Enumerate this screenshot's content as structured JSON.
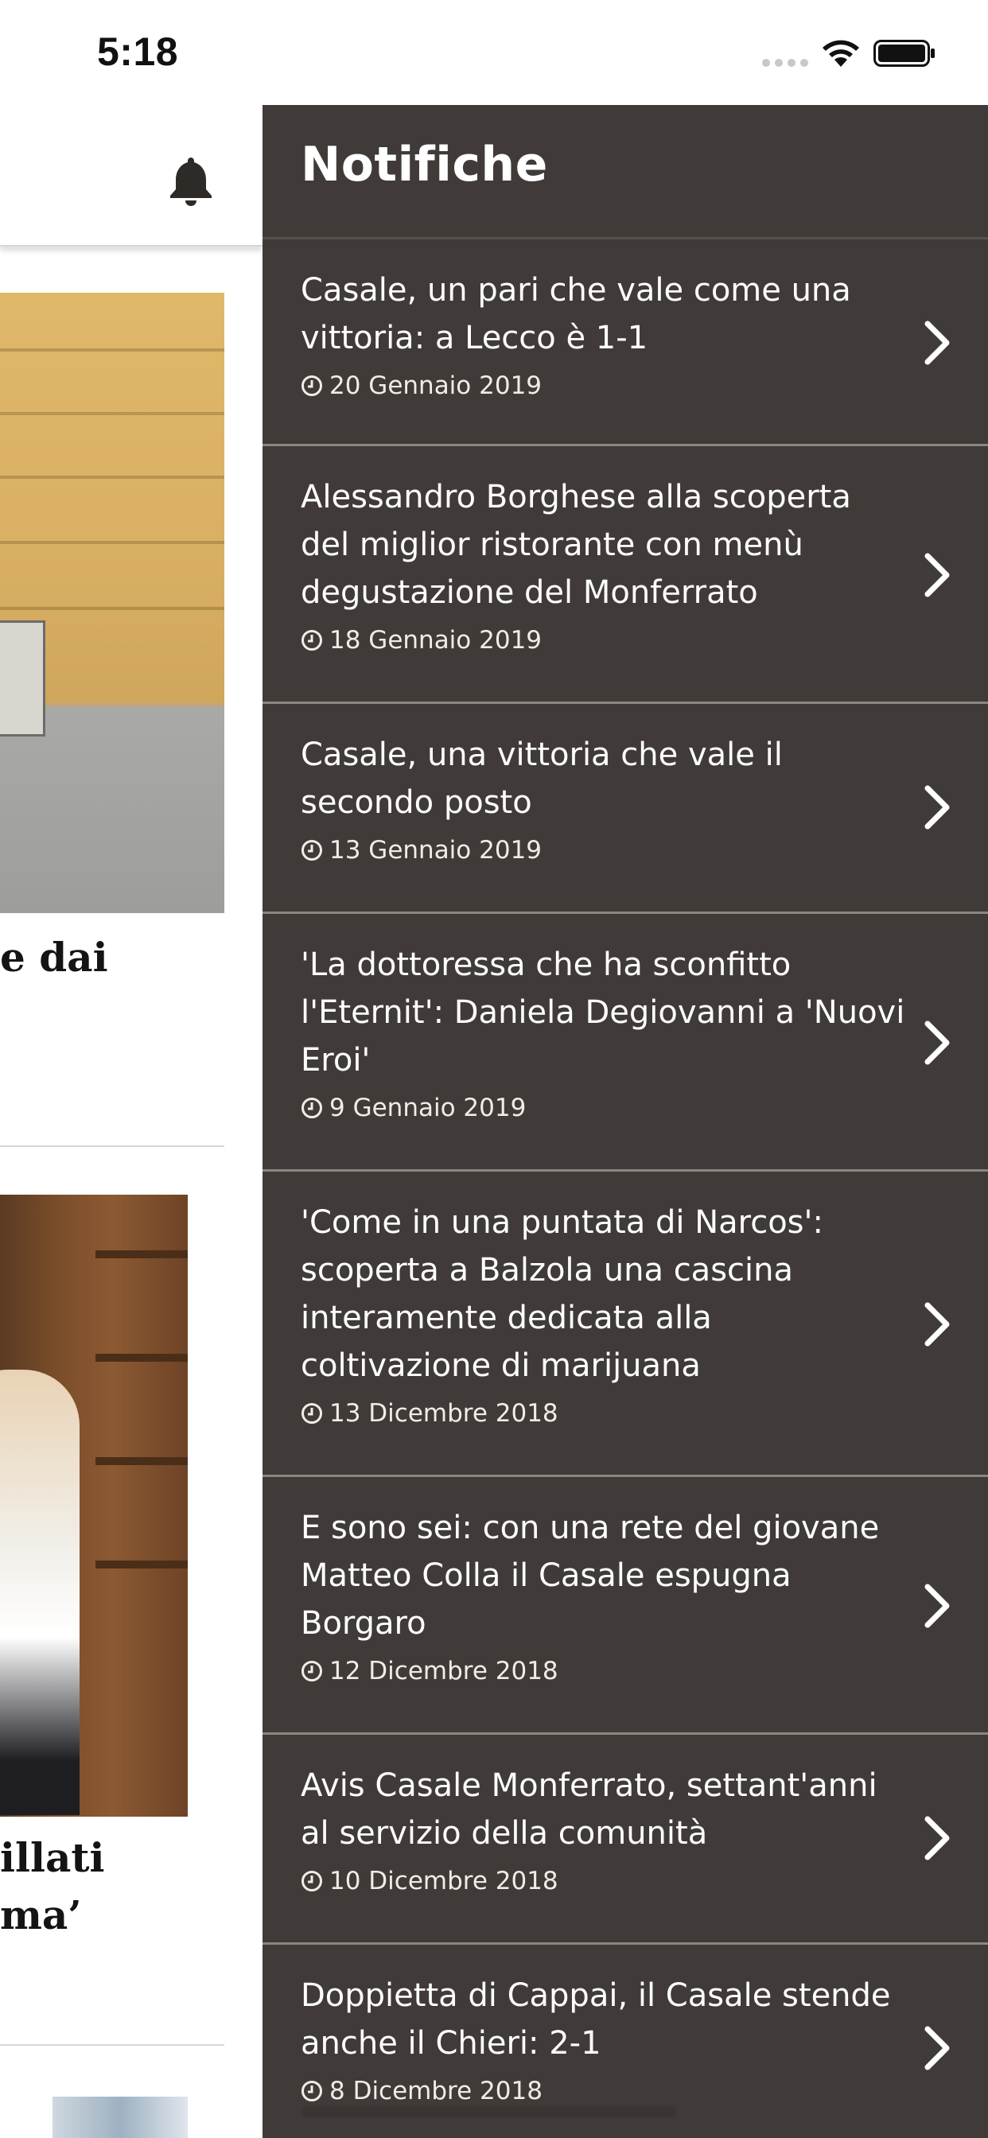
{
  "status_bar": {
    "time": "5:18",
    "icons": [
      "signal-icon",
      "wifi-icon",
      "battery-icon"
    ]
  },
  "background_app": {
    "header_icon": "bell-icon",
    "headline_1": [
      "e dai"
    ],
    "headline_2": [
      "illati",
      "ma’"
    ]
  },
  "drawer": {
    "title": "Notifiche",
    "colors": {
      "background": "#403b38",
      "separator": "#8c8681",
      "text": "#ffffff"
    },
    "items": [
      {
        "title": "Casale, un pari che vale come una vittoria: a Lecco è 1-1",
        "date": "20 Gennaio 2019"
      },
      {
        "title": "Alessandro Borghese alla scoperta del miglior ristorante con menù degustazione del Monferrato",
        "date": "18 Gennaio 2019"
      },
      {
        "title": "Casale, una vittoria che vale il secondo posto",
        "date": "13 Gennaio 2019"
      },
      {
        "title": "'La dottoressa che ha sconfitto l'Eternit': Daniela Degiovanni a 'Nuovi Eroi'",
        "date": "9 Gennaio 2019"
      },
      {
        "title": "'Come in una puntata di Narcos': scoperta a Balzola una cascina interamente dedicata alla coltivazione di marijuana",
        "date": "13 Dicembre 2018"
      },
      {
        "title": "E sono sei: con una rete del giovane Matteo Colla il Casale espugna Borgaro",
        "date": "12 Dicembre 2018"
      },
      {
        "title": "Avis Casale Monferrato, settant'anni al servizio della comunità",
        "date": "10 Dicembre 2018"
      },
      {
        "title": "Doppietta di Cappai, il Casale stende anche il Chieri: 2-1",
        "date": "8 Dicembre 2018"
      }
    ]
  }
}
